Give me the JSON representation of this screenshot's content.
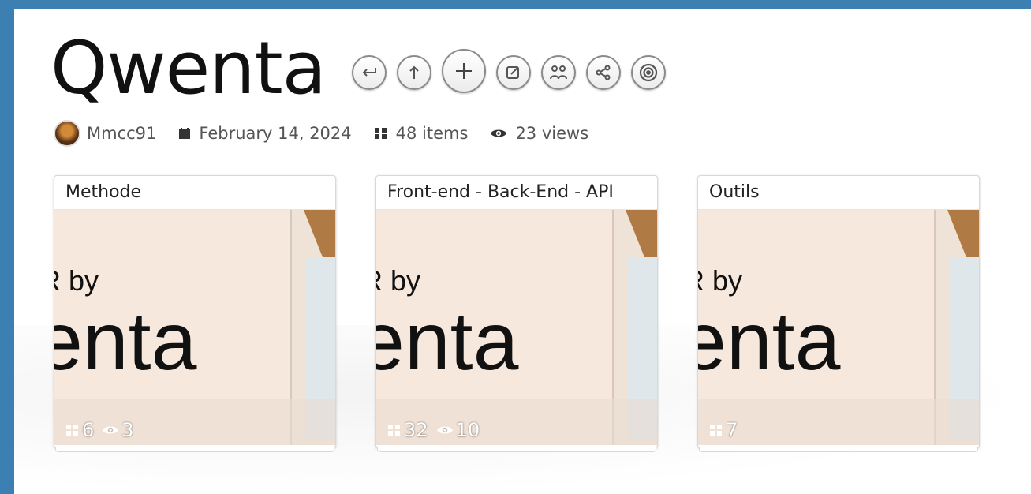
{
  "collection": {
    "title": "Qwenta",
    "author": "Mmcc91",
    "date": "February 14, 2024",
    "items": "48 items",
    "views": "23 views"
  },
  "actions": [
    {
      "name": "back-icon"
    },
    {
      "name": "up-icon"
    },
    {
      "name": "add-icon"
    },
    {
      "name": "edit-icon"
    },
    {
      "name": "collaborators-icon"
    },
    {
      "name": "share-icon"
    },
    {
      "name": "follow-icon"
    }
  ],
  "cards": [
    {
      "title": "Methode",
      "items": "6",
      "views": "3",
      "thumb_text_1": "R by",
      "thumb_text_2": "enta"
    },
    {
      "title": "Front-end - Back-End - API",
      "items": "32",
      "views": "10",
      "thumb_text_1": "R by",
      "thumb_text_2": "enta"
    },
    {
      "title": "Outils",
      "items": "7",
      "views": "",
      "thumb_text_1": "R by",
      "thumb_text_2": "enta"
    }
  ],
  "colors": {
    "frame": "#3b7fb3",
    "thumb_bg": "#f7e8dd"
  }
}
